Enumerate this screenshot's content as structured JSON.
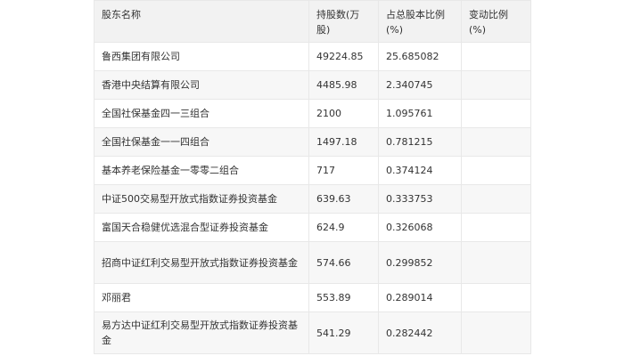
{
  "table": {
    "headers": [
      "股东名称",
      "持股数(万股)",
      "占总股本比例(%)",
      "变动比例(%)"
    ],
    "rows": [
      {
        "name": "鲁西集团有限公司",
        "shares": "49224.85",
        "ratio": "25.685082",
        "change": ""
      },
      {
        "name": "香港中央结算有限公司",
        "shares": "4485.98",
        "ratio": "2.340745",
        "change": ""
      },
      {
        "name": "全国社保基金四一三组合",
        "shares": "2100",
        "ratio": "1.095761",
        "change": ""
      },
      {
        "name": "全国社保基金一一四组合",
        "shares": "1497.18",
        "ratio": "0.781215",
        "change": ""
      },
      {
        "name": "基本养老保险基金一零零二组合",
        "shares": "717",
        "ratio": "0.374124",
        "change": ""
      },
      {
        "name": "中证500交易型开放式指数证券投资基金",
        "shares": "639.63",
        "ratio": "0.333753",
        "change": ""
      },
      {
        "name": "富国天合稳健优选混合型证券投资基金",
        "shares": "624.9",
        "ratio": "0.326068",
        "change": ""
      },
      {
        "name": "招商中证红利交易型开放式指数证券投资基金",
        "shares": "574.66",
        "ratio": "0.299852",
        "change": ""
      },
      {
        "name": "邓丽君",
        "shares": "553.89",
        "ratio": "0.289014",
        "change": ""
      },
      {
        "name": "易方达中证红利交易型开放式指数证券投资基金",
        "shares": "541.29",
        "ratio": "0.282442",
        "change": ""
      }
    ]
  }
}
